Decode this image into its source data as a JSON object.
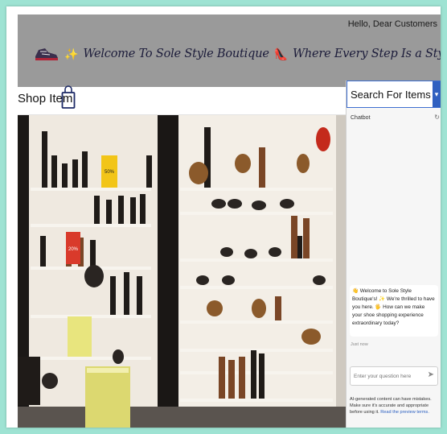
{
  "banner": {
    "greeting": "Hello, Dear Customers",
    "welcome_text": "Welcome To Sole Style Boutique",
    "tagline": "Where Every Step Is a Style Statement",
    "sparkle": "✨",
    "heel": "👠"
  },
  "header": {
    "title": "Shop Item"
  },
  "search_panel": {
    "title": "Search For Items",
    "chatbot_label": "Chatbot",
    "message": "👋 Welcome to Sole Style Boutique's! ✨ We're thrilled to have you here. 🖐 How can we make your shoe shopping experience extraordinary today?",
    "timestamp": "Just now",
    "input_placeholder": "Enter your question here",
    "disclaimer": "AI-generated content can have mistakes. Make sure it's accurate and appropriate before using it.",
    "disclaimer_link": "Read the preview terms."
  },
  "store_signs": {
    "sale_yellow": "50%",
    "sale_red": "20%"
  },
  "colors": {
    "page_border": "#9ee3d3",
    "banner_bg": "#9a9a9a",
    "accent_blue": "#3060c0"
  }
}
